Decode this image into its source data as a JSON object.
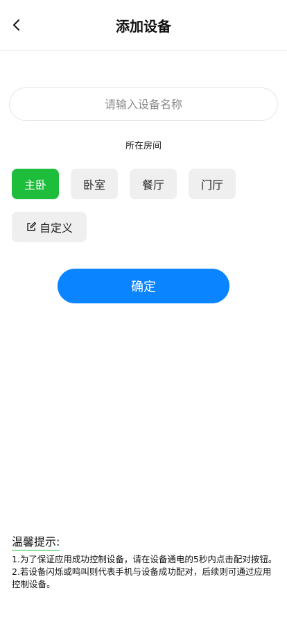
{
  "header": {
    "title": "添加设备",
    "back_icon": "chevron-left-icon"
  },
  "form": {
    "name_placeholder": "请输入设备名称",
    "name_value": "",
    "room_label": "所在房间",
    "rooms": [
      "主卧",
      "卧室",
      "餐厅",
      "门厅"
    ],
    "selected_room": "主卧",
    "custom_label": "自定义",
    "custom_icon": "edit-icon",
    "confirm_label": "确定"
  },
  "tips": {
    "title": "温馨提示:",
    "lines": [
      "1.为了保证应用成功控制设备，请在设备通电的5秒内点击配对按钮。",
      "2.若设备闪烁或鸣叫则代表手机与设备成功配对，后续则可通过应用控制设备。"
    ]
  },
  "colors": {
    "active_chip": "#1ebd3b",
    "chip_bg": "#efefef",
    "primary_button": "#0a84ff"
  }
}
